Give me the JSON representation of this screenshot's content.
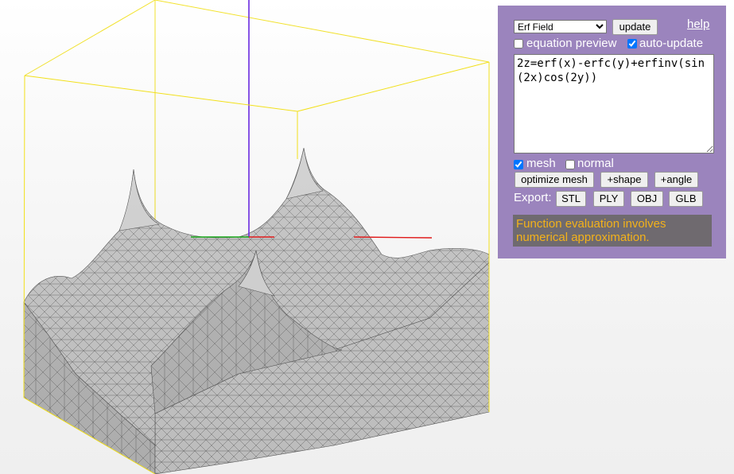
{
  "panel": {
    "function_select": {
      "selected": "Erf Field",
      "options": [
        "Erf Field"
      ]
    },
    "update_label": "update",
    "help_label": "help",
    "equation_preview": {
      "label": "equation preview",
      "checked": false
    },
    "auto_update": {
      "label": "auto-update",
      "checked": true
    },
    "equation": "2z=erf(x)-erfc(y)+erfinv(sin(2x)cos(2y))",
    "mesh": {
      "label": "mesh",
      "checked": true
    },
    "normal": {
      "label": "normal",
      "checked": false
    },
    "optimize_label": "optimize mesh",
    "shape_label": "+shape",
    "angle_label": "+angle",
    "export_label": "Export:",
    "export_formats": [
      "STL",
      "PLY",
      "OBJ",
      "GLB"
    ],
    "note": "Function evaluation involves numerical approximation."
  },
  "colors": {
    "panel_bg": "#9b84bd",
    "bounding_box": "#f2e01a",
    "axis_x": "#e01a1a",
    "axis_y": "#19a81a",
    "axis_z": "#6a2ae0",
    "mesh_fill": "#c8c8c8",
    "note_text": "#f3b21a",
    "note_bg": "#6f6a6f"
  }
}
